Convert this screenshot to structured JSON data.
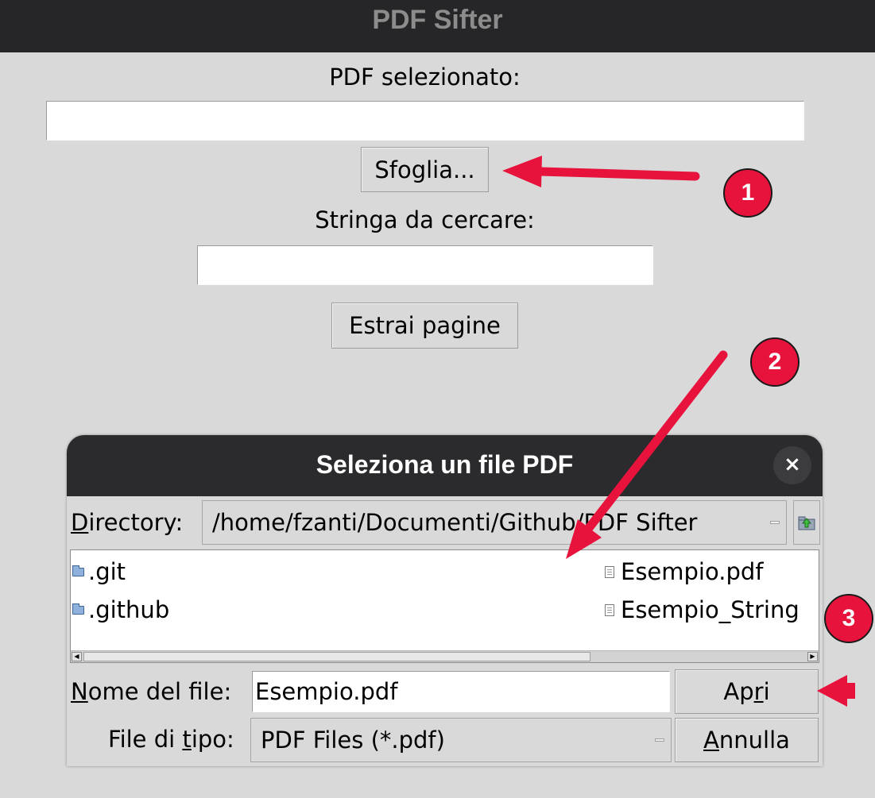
{
  "window": {
    "title": "PDF Sifter"
  },
  "main": {
    "pdf_label": "PDF selezionato:",
    "pdf_value": "",
    "browse_button": "Sfoglia...",
    "search_label": "Stringa da cercare:",
    "search_value": "",
    "extract_button": "Estrai pagine"
  },
  "dialog": {
    "title": "Seleziona un file PDF",
    "close_glyph": "×",
    "directory_label_underlined": "D",
    "directory_label_rest": "irectory:",
    "directory_path": "/home/fzanti/Documenti/Github/PDF Sifter",
    "files": {
      "folders": [
        ".git",
        ".github"
      ],
      "documents": [
        "Esempio.pdf",
        "Esempio_String"
      ]
    },
    "filename_label_underlined": "N",
    "filename_label_rest": "ome del file:",
    "filename_value": "Esempio.pdf",
    "filetype_label_pre": "File di ",
    "filetype_label_underlined": "t",
    "filetype_label_rest": "ipo:",
    "filetype_value": "PDF Files (*.pdf)",
    "open_button_pre": "Ap",
    "open_button_underlined": "r",
    "open_button_rest": "i",
    "cancel_button_underlined": "A",
    "cancel_button_rest": "nnulla"
  },
  "annotations": {
    "markers": [
      "1",
      "2",
      "3"
    ],
    "color": "#e8133c"
  },
  "icons": [
    "folder-icon",
    "document-icon",
    "parent-directory-icon",
    "close-icon"
  ]
}
